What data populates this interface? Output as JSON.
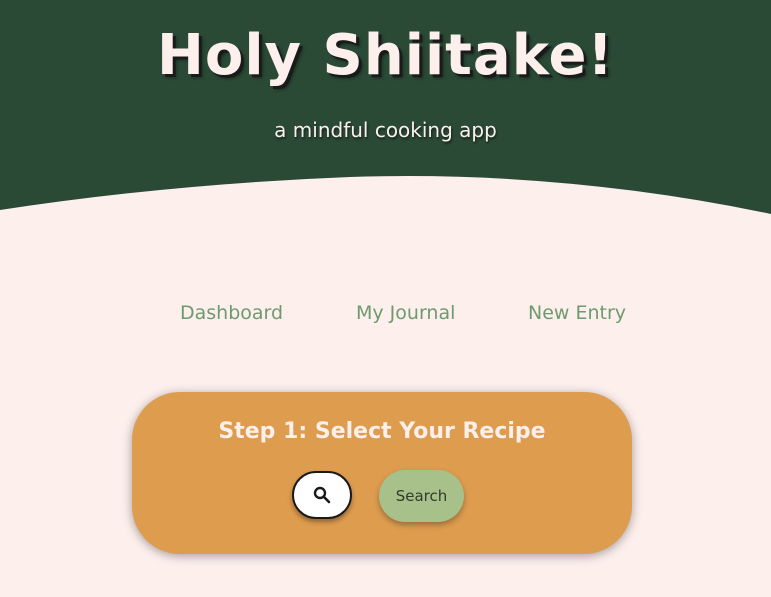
{
  "header": {
    "app_title": "Holy Shiitake!",
    "subtitle": "a mindful cooking app",
    "background_color": "#2a4a36",
    "text_color": "#fcefec"
  },
  "nav": {
    "items": [
      {
        "label": "Dashboard"
      },
      {
        "label": "My Journal"
      },
      {
        "label": "New Entry"
      }
    ],
    "link_color": "#6f9a6f"
  },
  "recipe_card": {
    "title": "Step 1: Select Your Recipe",
    "background_color": "#de9c4f",
    "search_icon": "search-icon",
    "search_input_value": "",
    "search_button_label": "Search",
    "search_button_color": "#a8c08a"
  },
  "page": {
    "background_color": "#fcefec"
  }
}
